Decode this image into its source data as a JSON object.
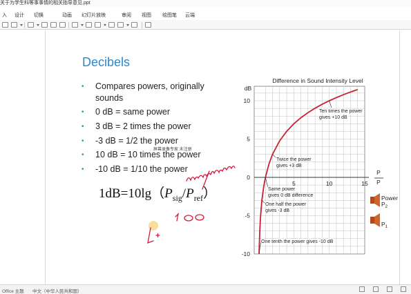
{
  "window": {
    "title": "关于为学生科等事事情的相关指导意见.ppt"
  },
  "menu": {
    "items": [
      "入",
      "设计",
      "切换",
      "动画",
      "幻灯片放映",
      "审阅",
      "视图",
      "绘图笔",
      "云端"
    ]
  },
  "slide": {
    "title": "Decibels",
    "bullets": [
      "Compares powers, originally",
      "sounds",
      "0 dB = same power",
      "3 dB = 2 times the power",
      "-3 dB = 1/2 the power",
      "10 dB = 10 times the power",
      "-10 dB = 1/10 the power"
    ],
    "watermark": "屏幕录像专家 未注册",
    "formula": {
      "lhs": "1dB=10lg（",
      "p": "P",
      "sub_sig": "sig",
      "slash": "/",
      "sub_ref": "ref",
      "rhs": "）"
    },
    "annotation_ink": {
      "word": "woman/man",
      "number": "100",
      "mark": "L+"
    }
  },
  "chart_data": {
    "type": "line",
    "title": "Difference in Sound Intensity Level",
    "ylabel": "dB",
    "x_axis_label": "P2/P1",
    "xlim": [
      0,
      15
    ],
    "ylim": [
      -10,
      12
    ],
    "x_ticks": [
      0,
      5,
      10,
      15
    ],
    "y_ticks": [
      -10,
      -5,
      0,
      5,
      10
    ],
    "grid": true,
    "series": [
      {
        "x": [
          0.1,
          0.2,
          0.3,
          0.5,
          0.75,
          1,
          1.5,
          2,
          3,
          4,
          5,
          6,
          7,
          8,
          9,
          10,
          11,
          12,
          13,
          14
        ],
        "y": [
          -10,
          -6.99,
          -5.23,
          -3.01,
          -1.25,
          0,
          1.76,
          3.01,
          4.77,
          6.02,
          6.99,
          7.78,
          8.45,
          9.03,
          9.54,
          10,
          10.41,
          10.79,
          11.14,
          11.46
        ]
      }
    ],
    "annotations": [
      {
        "text": [
          "Ten times the power",
          "gives +10 dB"
        ],
        "x": 10,
        "y": 10
      },
      {
        "text": [
          "Twice the power",
          "gives +3 dB"
        ],
        "x": 2,
        "y": 3
      },
      {
        "text": [
          "Same power",
          "gives 0 dB difference"
        ],
        "x": 1,
        "y": 0
      },
      {
        "text": [
          "One half the power",
          "gives -3 dB"
        ],
        "x": 0.5,
        "y": -3
      },
      {
        "text": [
          "One tenth the power gives -10 dB"
        ],
        "x": 0.1,
        "y": -10
      }
    ],
    "legend": {
      "title": "Power",
      "items": [
        "P2",
        "P1"
      ]
    }
  },
  "statusbar": {
    "left": "Office 主题",
    "language": "中文（中华人民共和国）"
  }
}
